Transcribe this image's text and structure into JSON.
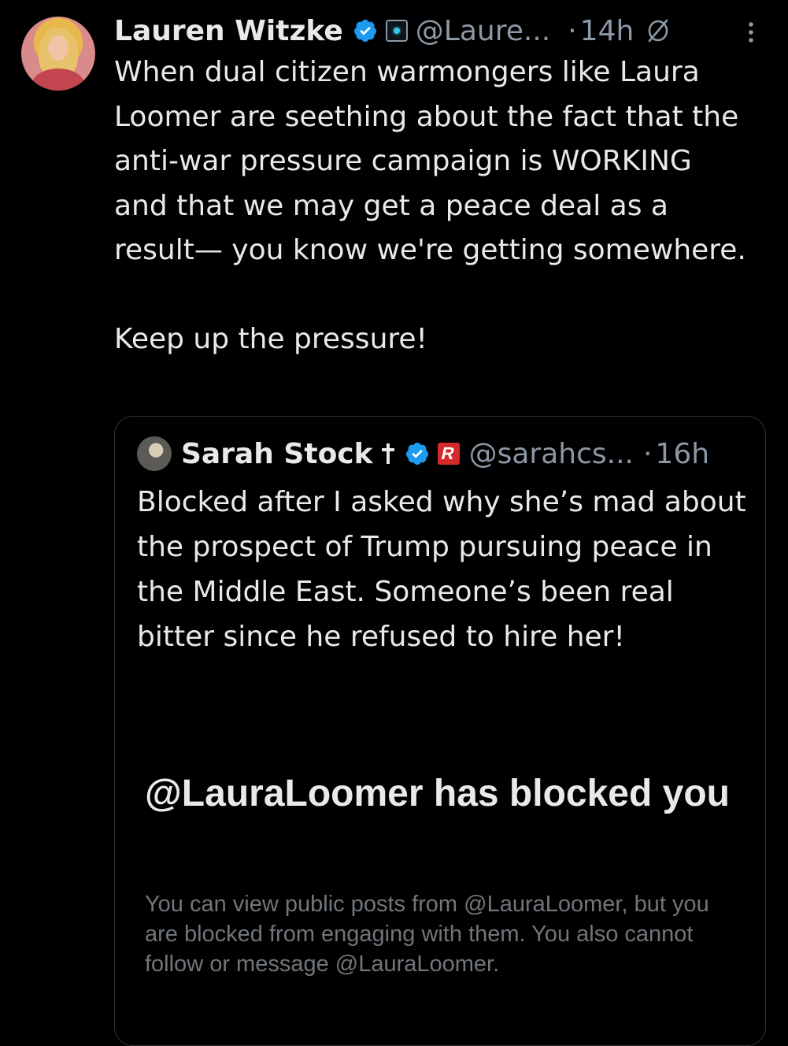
{
  "tweet": {
    "author_name": "Lauren Witzke",
    "handle": "@Laure...",
    "separator": "·",
    "time": "14h",
    "text_paragraph_1": "When dual citizen warmongers like Laura Loomer are seething about the fact that the anti-war pressure campaign is WORKING and that we may get a peace deal as a result— you know we're getting somewhere.",
    "text_paragraph_2": "Keep up the pressure!"
  },
  "quote": {
    "author_name": "Sarah Stock",
    "handle": "@sarahcs...",
    "separator": "·",
    "time": "16h",
    "text": "Blocked after I asked why she’s mad about the prospect of Trump pursuing peace in the Middle East. Someone’s been real bitter since he refused to hire her!",
    "embedded_screenshot": {
      "title": "@LauraLoomer has blocked you",
      "body": "You can view public posts from @LauraLoomer, but you are blocked from engaging with them. You also cannot follow or message @LauraLoomer."
    }
  },
  "icons": {
    "verified": "verified-badge-icon",
    "affiliation": "affiliation-badge-icon",
    "restricted": "no-replies-icon",
    "more": "more-options-icon",
    "cross": "cross-icon"
  },
  "colors": {
    "background": "#000000",
    "primary_text": "#e7e9ea",
    "secondary_text": "#8b98a5",
    "verified_blue": "#1d9bf0",
    "border": "#2f3336"
  }
}
